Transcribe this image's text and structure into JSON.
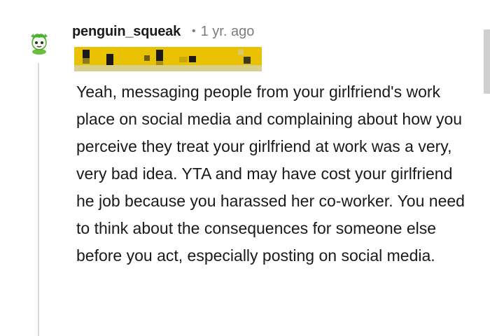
{
  "comment": {
    "username": "penguin_squeak",
    "separator": "•",
    "timestamp": "1 yr. ago",
    "avatar_icon": "snoo-avatar-icon",
    "flair_color": "#e8c200",
    "body": "Yeah, messaging people from your girlfriend's work place on social media and complaining about how you perceive they treat your girlfriend at work was a very, very bad idea. YTA and may have cost your girlfriend he job because you harassed her co-worker. You need to think about the consequences for someone else before you act, especially posting on social media."
  }
}
